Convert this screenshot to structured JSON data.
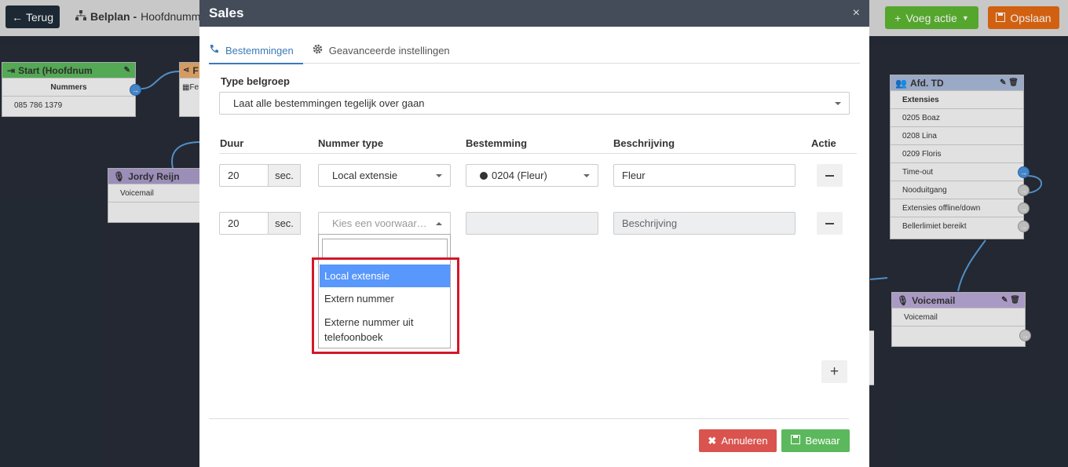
{
  "topbar": {
    "back_label": "Terug",
    "breadcrumb_title": "Belplan -",
    "breadcrumb_sub": "Hoofdnumme",
    "add_action_label": "Voeg actie",
    "save_label": "Opslaan"
  },
  "canvas": {
    "start_node": {
      "title": "Start (Hoofdnum",
      "header": "Nummers",
      "number": "085 786 1379"
    },
    "mid_node": {
      "title": "F",
      "row": "Fe"
    },
    "jordy_node": {
      "title": "Jordy Reijn",
      "row": "Voicemail"
    },
    "afd_node": {
      "title": "Afd. TD",
      "header": "Extensies",
      "rows": [
        "0205 Boaz",
        "0208 Lina",
        "0209 Floris",
        "Time-out",
        "Nooduitgang",
        "Extensies offline/down",
        "Bellerlimiet bereikt"
      ]
    },
    "voicemail_node": {
      "title": "Voicemail",
      "row": "Voicemail"
    }
  },
  "modal": {
    "title": "Sales",
    "close": "×",
    "tabs": [
      {
        "label": "Bestemmingen"
      },
      {
        "label": "Geavanceerde instellingen"
      }
    ],
    "type_label": "Type belgroep",
    "type_value": "Laat alle bestemmingen tegelijk over gaan",
    "columns": {
      "duur": "Duur",
      "nummer_type": "Nummer type",
      "bestemming": "Bestemming",
      "beschrijving": "Beschrijving",
      "actie": "Actie"
    },
    "rows": [
      {
        "duur": "20",
        "unit": "sec.",
        "nummer_type": "Local extensie",
        "bestemming": "0204 (Fleur)",
        "beschrijving": "Fleur"
      },
      {
        "duur": "20",
        "unit": "sec.",
        "nummer_type_placeholder": "Kies een voorwaar…",
        "bestemming": "",
        "beschrijving_placeholder": "Beschrijving"
      }
    ],
    "dropdown_options": [
      "Local extensie",
      "Extern nummer",
      "Externe nummer uit telefoonboek"
    ],
    "cancel_label": "Annuleren",
    "save_label": "Bewaar"
  },
  "colors": {
    "highlight_border": "#d3182a",
    "selected_option": "#5897fb",
    "tab_active": "#3b7ab8"
  }
}
